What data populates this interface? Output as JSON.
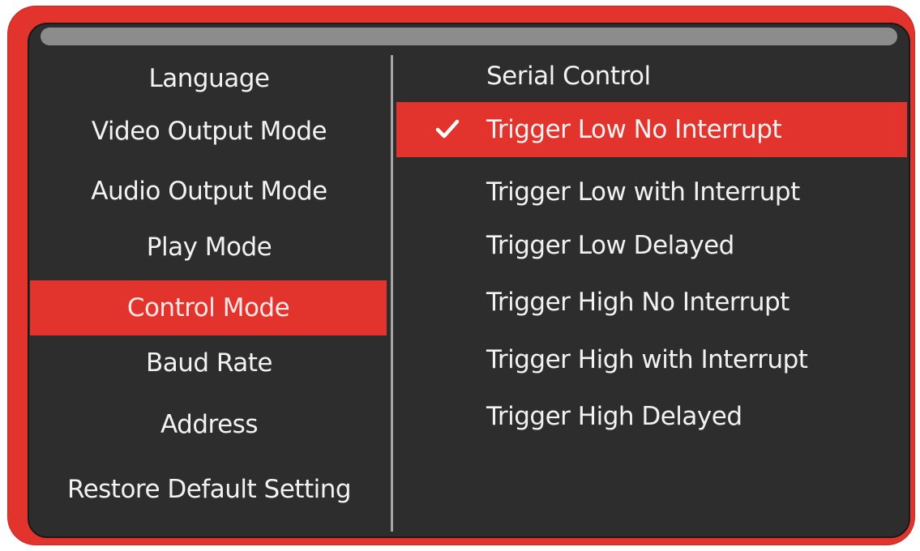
{
  "settings_menu": {
    "items": [
      {
        "label": "Language"
      },
      {
        "label": "Video Output Mode"
      },
      {
        "label": "Audio Output Mode"
      },
      {
        "label": "Play Mode"
      },
      {
        "label": "Control Mode",
        "selected": true
      },
      {
        "label": "Baud Rate"
      },
      {
        "label": "Address"
      },
      {
        "label": "Restore Default Setting"
      }
    ]
  },
  "control_mode_submenu": {
    "heading": "Serial Control",
    "options": [
      {
        "label": "Trigger Low No Interrupt",
        "checked": true,
        "selected": true
      },
      {
        "label": "Trigger Low with Interrupt"
      },
      {
        "label": "Trigger Low Delayed"
      },
      {
        "label": "Trigger High No Interrupt"
      },
      {
        "label": "Trigger High with Interrupt"
      },
      {
        "label": "Trigger High Delayed"
      }
    ]
  },
  "icons": {
    "check": "check-icon"
  },
  "colors": {
    "frame": "#e3332d",
    "highlight": "#e3332d",
    "screen_background": "#2e2d2d",
    "title_bar": "#8c8c8c",
    "divider": "#a6a6a6",
    "text": "#f2f2f2"
  }
}
